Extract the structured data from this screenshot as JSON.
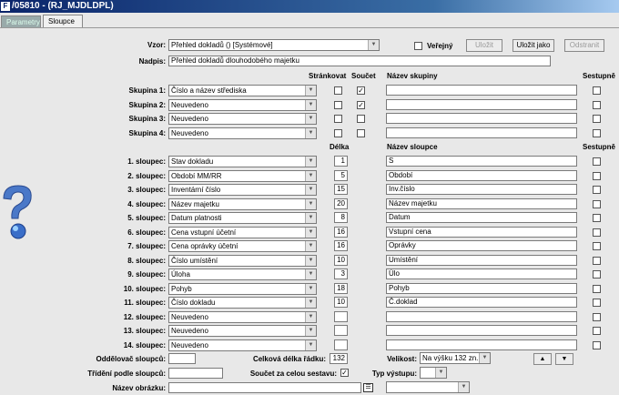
{
  "window": {
    "title": "/05810 - (RJ_MJDLDPL)",
    "icon": "app-icon"
  },
  "tabs": [
    {
      "label": "Parametry"
    },
    {
      "label": "Sloupce"
    }
  ],
  "vzor": {
    "label": "Vzor:",
    "value": "Přehled dokladů  ()  [Systémové]"
  },
  "verejny": {
    "label": "Veřejný",
    "checked": false
  },
  "buttons": {
    "ulozit": "Uložit",
    "ulozit_jako": "Uložit jako",
    "odstranit": "Odstranit"
  },
  "nadpis": {
    "label": "Nadpis:",
    "value": "Přehled dokladů dlouhodobého majetku"
  },
  "headers": {
    "strankovat": "Stránkovat",
    "soucet": "Součet",
    "nazev_skupiny": "Název skupiny",
    "sestupne": "Sestupně",
    "delka": "Délka",
    "nazev_sloupce": "Název sloupce"
  },
  "groups": [
    {
      "label": "Skupina 1:",
      "value": "Číslo a název střediska",
      "strankovat": false,
      "soucet": true,
      "name": "",
      "sestupne": false
    },
    {
      "label": "Skupina 2:",
      "value": "Neuvedeno",
      "strankovat": false,
      "soucet": true,
      "name": "",
      "sestupne": false
    },
    {
      "label": "Skupina 3:",
      "value": "Neuvedeno",
      "strankovat": false,
      "soucet": false,
      "name": "",
      "sestupne": false
    },
    {
      "label": "Skupina 4:",
      "value": "Neuvedeno",
      "strankovat": false,
      "soucet": false,
      "name": "",
      "sestupne": false
    }
  ],
  "columns": [
    {
      "label": "1. sloupec:",
      "value": "Stav dokladu",
      "delka": "1",
      "name": "S"
    },
    {
      "label": "2. sloupec:",
      "value": "Období MM/RR",
      "delka": "5",
      "name": "Období"
    },
    {
      "label": "3. sloupec:",
      "value": "Inventární číslo",
      "delka": "15",
      "name": "Inv.číslo"
    },
    {
      "label": "4. sloupec:",
      "value": "Název majetku",
      "delka": "20",
      "name": "Název majetku"
    },
    {
      "label": "5. sloupec:",
      "value": "Datum platnosti",
      "delka": "8",
      "name": "Datum"
    },
    {
      "label": "6. sloupec:",
      "value": "Cena vstupní účetní",
      "delka": "16",
      "name": "Vstupní cena"
    },
    {
      "label": "7. sloupec:",
      "value": "Cena oprávky účetní",
      "delka": "16",
      "name": "Oprávky"
    },
    {
      "label": "8. sloupec:",
      "value": "Číslo umístění",
      "delka": "10",
      "name": "Umístění"
    },
    {
      "label": "9. sloupec:",
      "value": "Úloha",
      "delka": "3",
      "name": "Úlo"
    },
    {
      "label": "10. sloupec:",
      "value": "Pohyb",
      "delka": "18",
      "name": "Pohyb"
    },
    {
      "label": "11. sloupec:",
      "value": "Číslo dokladu",
      "delka": "10",
      "name": "Č.doklad"
    },
    {
      "label": "12. sloupec:",
      "value": "Neuvedeno",
      "delka": "",
      "name": ""
    },
    {
      "label": "13. sloupec:",
      "value": "Neuvedeno",
      "delka": "",
      "name": ""
    },
    {
      "label": "14. sloupec:",
      "value": "Neuvedeno",
      "delka": "",
      "name": ""
    }
  ],
  "footer": {
    "oddelovac_label": "Oddělovač sloupců:",
    "oddelovac_value": "",
    "celkova_delka_label": "Celková délka řádku:",
    "celkova_delka_value": "132",
    "velikost_label": "Velikost:",
    "velikost_value": "Na výšku 132 zn.",
    "trideni_label": "Třídění podle sloupců:",
    "trideni_value": "",
    "soucet_sestavy_label": "Součet za celou sestavu:",
    "soucet_sestavy_checked": true,
    "typ_vystupu_label": "Typ výstupu:",
    "typ_vystupu_value": "",
    "nazev_obrazku_label": "Název obrázku:",
    "nazev_obrazku_value": "",
    "obrazek_select_value": ""
  },
  "icons": {
    "help": "help-question-icon",
    "move_up": "arrow-up-icon",
    "move_down": "arrow-down-icon",
    "list": "list-icon"
  }
}
